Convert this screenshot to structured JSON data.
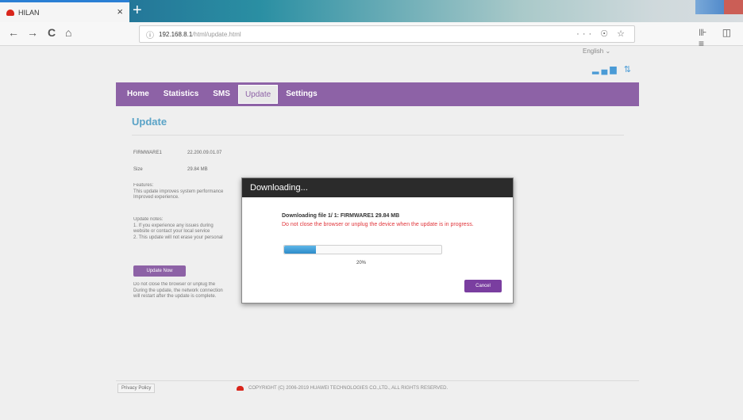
{
  "browser": {
    "tab_title": "HILAN",
    "tab_close": "×",
    "new_tab": "+",
    "nav": {
      "back": "←",
      "forward": "→",
      "reload": "C",
      "home": "⌂"
    },
    "url_host": "192.168.8.1",
    "url_path": "/html/update.html",
    "url_right": "··· ☉ ☆",
    "tools": "⊪ ◫ ≡"
  },
  "page": {
    "language": "English",
    "signal": "▂▄▆ ⇅",
    "menu": [
      "Home",
      "Statistics",
      "SMS",
      "Update",
      "Settings"
    ],
    "active_menu": "Update",
    "title": "Update",
    "firmware_label": "FIRMWARE1",
    "firmware_value": "22.200.09.01.07",
    "size_label": "Size",
    "size_value": "29.84 MB",
    "features_title": "Features:",
    "features_line1": "This update improves system performance",
    "features_line2": "Improved experience.",
    "notes_title": "Update notes:",
    "notes_line1": "1. If you experience any issues during",
    "notes_line2": "website or contact your local service",
    "notes_line3": "2. This update will not erase your personal",
    "update_button": "Update Now",
    "warn_line1": "Do not close the browser or unplug the",
    "warn_line2": "During the update, the network connection",
    "warn_line3": "will restart after the update is complete.",
    "privacy": "Privacy Policy",
    "copyright": "COPYRIGHT (C) 2006-2019 HUAWEI TECHNOLOGIES CO.,LTD., ALL RIGHTS RESERVED."
  },
  "dialog": {
    "title": "Downloading...",
    "status": "Downloading file 1/ 1: FIRMWARE1 29.84 MB",
    "warning": "Do not close the browser or unplug the device when the update is in progress.",
    "progress": 0.2,
    "percent_label": "20%",
    "cancel": "Cancel"
  },
  "colors": {
    "accent": "#8d62a6",
    "progress": "#2d8bc9",
    "warning": "#e0353b",
    "title": "#5aa3c7"
  }
}
